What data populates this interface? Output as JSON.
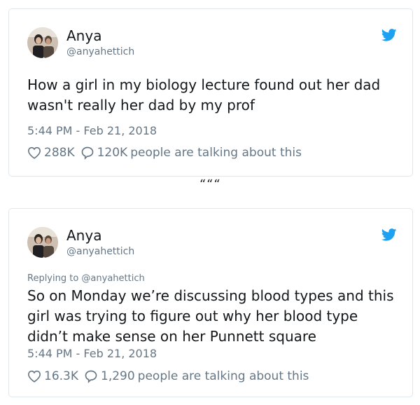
{
  "tweets": [
    {
      "name": "Anya",
      "handle": "@anyahettich",
      "replying_to": "",
      "text": "How a girl in my biology lecture found out her dad wasn't really her dad by my prof",
      "timestamp": "5:44 PM - Feb 21, 2018",
      "likes": "288K",
      "replies": "120K",
      "talk_text": "people are talking about this"
    },
    {
      "name": "Anya",
      "handle": "@anyahettich",
      "replying_to": "Replying to @anyahettich",
      "text": "So on Monday we’re discussing blood types and this girl was trying to figure out why her blood type didn’t make sense on her Punnett square",
      "timestamp": "5:44 PM - Feb 21, 2018",
      "likes": "16.3K",
      "replies": "1,290",
      "talk_text": "people are talking about this"
    }
  ],
  "separator": "“““",
  "colors": {
    "twitter_blue": "#1da1f2",
    "muted": "#657786",
    "text": "#14171a",
    "border": "#e1e8ed"
  },
  "icons": {
    "brand": "twitter-bird-icon",
    "like": "heart-icon",
    "reply": "speech-bubble-icon"
  }
}
